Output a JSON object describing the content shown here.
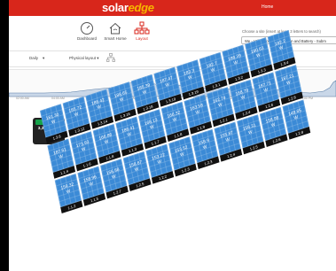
{
  "header": {
    "logo_main": "solar",
    "logo_accent": "edge",
    "home_link": "Home"
  },
  "nav": {
    "dashboard": "Dashboard",
    "smart_home": "Smart Home",
    "layout": "Layout"
  },
  "site": {
    "label": "Choose a site (insert at least 3 letters to search)",
    "selected": "We - Utility Home Automation and Battery - Subm"
  },
  "controls": {
    "period": "Daily",
    "layout_view": "Physical layout ▾"
  },
  "timeline": {
    "ticks": [
      "02:00 AM",
      "04:00 AM",
      "06:00 AM",
      "08:00 AM",
      "10:00 AM",
      "12:00 PM",
      "02:00 PM",
      "04:00 PM",
      "06:00 PM"
    ]
  },
  "inverter": {
    "value": "3,345.52 W"
  },
  "panels": [
    {
      "v": "181.30",
      "id": "1.3.8"
    },
    {
      "v": "185.72",
      "id": "1.3.12"
    },
    {
      "v": "186.42",
      "id": "1.3.14"
    },
    {
      "v": "188.65",
      "id": "1.3.16"
    },
    {
      "v": "185.39",
      "id": "1.3.18"
    },
    {
      "v": "187.47",
      "id": "1.3.19"
    },
    {
      "v": "183.3",
      "id": "1.3.19"
    },
    {
      "v": "182.7",
      "id": "1.3.1"
    },
    {
      "v": "186.39",
      "id": "1.3.2"
    },
    {
      "v": "180.63",
      "id": "1.3.3"
    },
    {
      "v": "182.2",
      "id": "1.3.4"
    },
    {
      "v": "187.61",
      "id": "1.1.4"
    },
    {
      "v": "173.93",
      "id": "1.1.6"
    },
    {
      "v": "166.86",
      "id": "1.1.8"
    },
    {
      "v": "186.41",
      "id": "1.1.3"
    },
    {
      "v": "168.13",
      "id": "1.1.7"
    },
    {
      "v": "166.32",
      "id": "1.1.8"
    },
    {
      "v": "163.58",
      "id": "1.1.9"
    },
    {
      "v": "162.74",
      "id": "1.2.1"
    },
    {
      "v": "168.79",
      "id": "1.2.4"
    },
    {
      "v": "187.71",
      "id": "1.2.6"
    },
    {
      "v": "187.21",
      "id": "1.2.8"
    },
    {
      "v": "159.32",
      "id": "1.1.2"
    },
    {
      "v": "158.96",
      "id": "1.1.5"
    },
    {
      "v": "156.88",
      "id": "1.2.7"
    },
    {
      "v": "158.67",
      "id": "1.2.5"
    },
    {
      "v": "153.22",
      "id": "1.2.2"
    },
    {
      "v": "153.52",
      "id": "1.2.3"
    },
    {
      "v": "158.9",
      "id": "1.2.3"
    },
    {
      "v": "155.87",
      "id": "1.2.4"
    },
    {
      "v": "158.31",
      "id": "1.2.5"
    },
    {
      "v": "158.98",
      "id": "1.2.6"
    },
    {
      "v": "148.65",
      "id": "1.2.8"
    }
  ],
  "panel_unit": "W",
  "colors": {
    "brand_red": "#d8261b",
    "panel_blue": "#3b8ad6",
    "inverter_green": "#16a34a"
  }
}
